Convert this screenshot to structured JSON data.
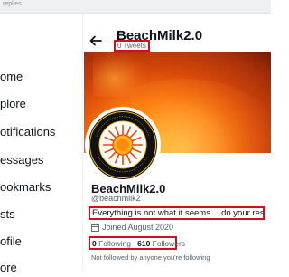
{
  "top_strip": {
    "text": "replies"
  },
  "nav": {
    "items": [
      {
        "label": "ome"
      },
      {
        "label": "plore"
      },
      {
        "label": "otifications"
      },
      {
        "label": "essages"
      },
      {
        "label": "ookmarks"
      },
      {
        "label": "sts"
      },
      {
        "label": "ofile"
      },
      {
        "label": "ore"
      }
    ]
  },
  "header": {
    "name": "BeachMilk2.0",
    "tweets": "0 Tweets"
  },
  "profile": {
    "name": "BeachMilk2.0",
    "handle": "@beachmilk2",
    "bio": "Everything is not what it seems….do your research!",
    "joined": "Joined August 2020",
    "following_count": "0",
    "following_label": "Following",
    "followers_count": "610",
    "followers_label": "Followers",
    "followed_note": "Not followed by anyone you're following"
  },
  "avatar_badge": {
    "outer_text_top": "SUPPORTING GLOBAL AWARENESS",
    "outer_text_bottom": "IT'S THE SUN STUPID"
  },
  "colors": {
    "highlight_red": "#d00f1f",
    "secondary_text": "#536471",
    "banner_orange": "#ff7a0d"
  }
}
